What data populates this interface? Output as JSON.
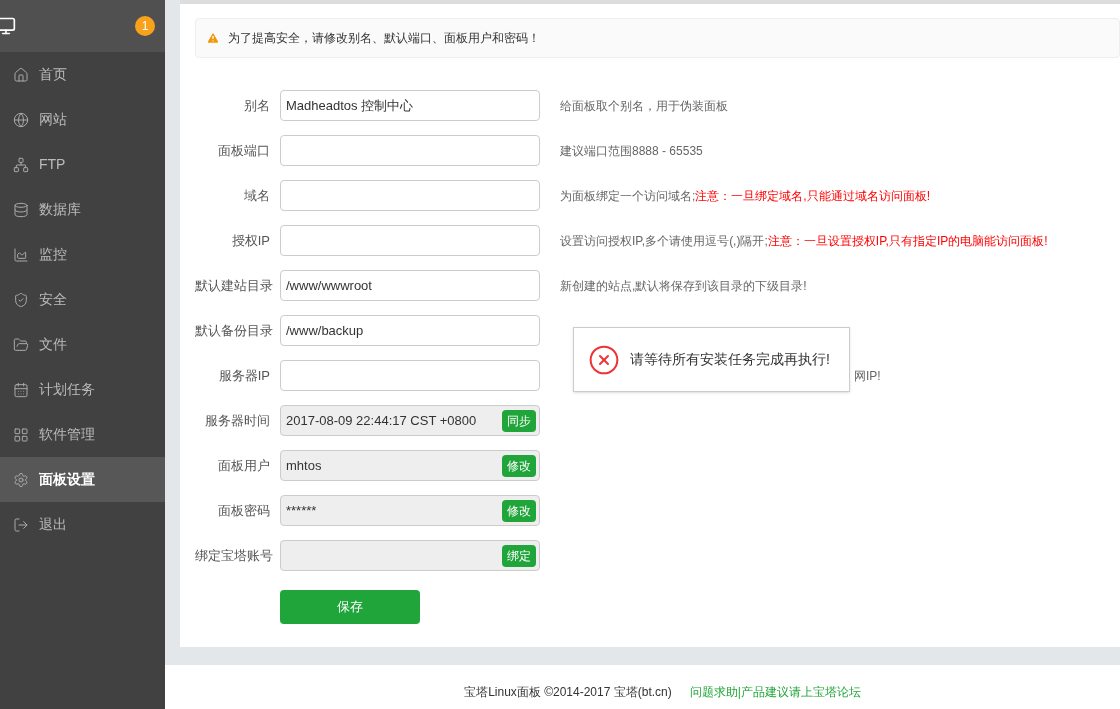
{
  "sidebar": {
    "badge": "1",
    "items": [
      {
        "label": "首页",
        "selected": false
      },
      {
        "label": "网站",
        "selected": false
      },
      {
        "label": "FTP",
        "selected": false
      },
      {
        "label": "数据库",
        "selected": false
      },
      {
        "label": "监控",
        "selected": false
      },
      {
        "label": "安全",
        "selected": false
      },
      {
        "label": "文件",
        "selected": false
      },
      {
        "label": "计划任务",
        "selected": false
      },
      {
        "label": "软件管理",
        "selected": false
      },
      {
        "label": "面板设置",
        "selected": true
      },
      {
        "label": "退出",
        "selected": false
      }
    ]
  },
  "alert": "为了提高安全，请修改别名、默认端口、面板用户和密码！",
  "form": [
    {
      "label": "别名",
      "kind": "text",
      "value": "Madheadtos 控制中心",
      "hint": "给面板取个别名，用于伪装面板"
    },
    {
      "label": "面板端口",
      "kind": "text",
      "hint": "建议端口范围8888 - 65535"
    },
    {
      "label": "域名",
      "kind": "text",
      "hint": "为面板绑定一个访问域名;",
      "warning": "注意：一旦绑定域名,只能通过域名访问面板!"
    },
    {
      "label": "授权IP",
      "kind": "text",
      "hint": "设置访问授权IP,多个请使用逗号(,)隔开;",
      "warning": "注意：一旦设置授权IP,只有指定IP的电脑能访问面板!"
    },
    {
      "label": "默认建站目录",
      "kind": "text",
      "value": "/www/wwwroot",
      "hint": "新创建的站点,默认将保存到该目录的下级目录!"
    },
    {
      "label": "默认备份目录",
      "kind": "text",
      "value": "/www/backup"
    },
    {
      "label": "服务器IP",
      "kind": "text",
      "hint_tail": "网IP!"
    },
    {
      "label": "服务器时间",
      "kind": "action",
      "value": "2017-08-09 22:44:17 CST +0800",
      "button": "同步"
    },
    {
      "label": "面板用户",
      "kind": "action",
      "value": "mhtos",
      "button": "修改"
    },
    {
      "label": "面板密码",
      "kind": "action",
      "value": "******",
      "button": "修改"
    },
    {
      "label": "绑定宝塔账号",
      "kind": "action",
      "button": "绑定"
    }
  ],
  "save": "保存",
  "toast": {
    "message": "请等待所有安装任务完成再执行!"
  },
  "footer": {
    "copyright": "宝塔Linux面板 ©2014-2017 宝塔(bt.cn)",
    "link": "问题求助|产品建议请上宝塔论坛"
  }
}
